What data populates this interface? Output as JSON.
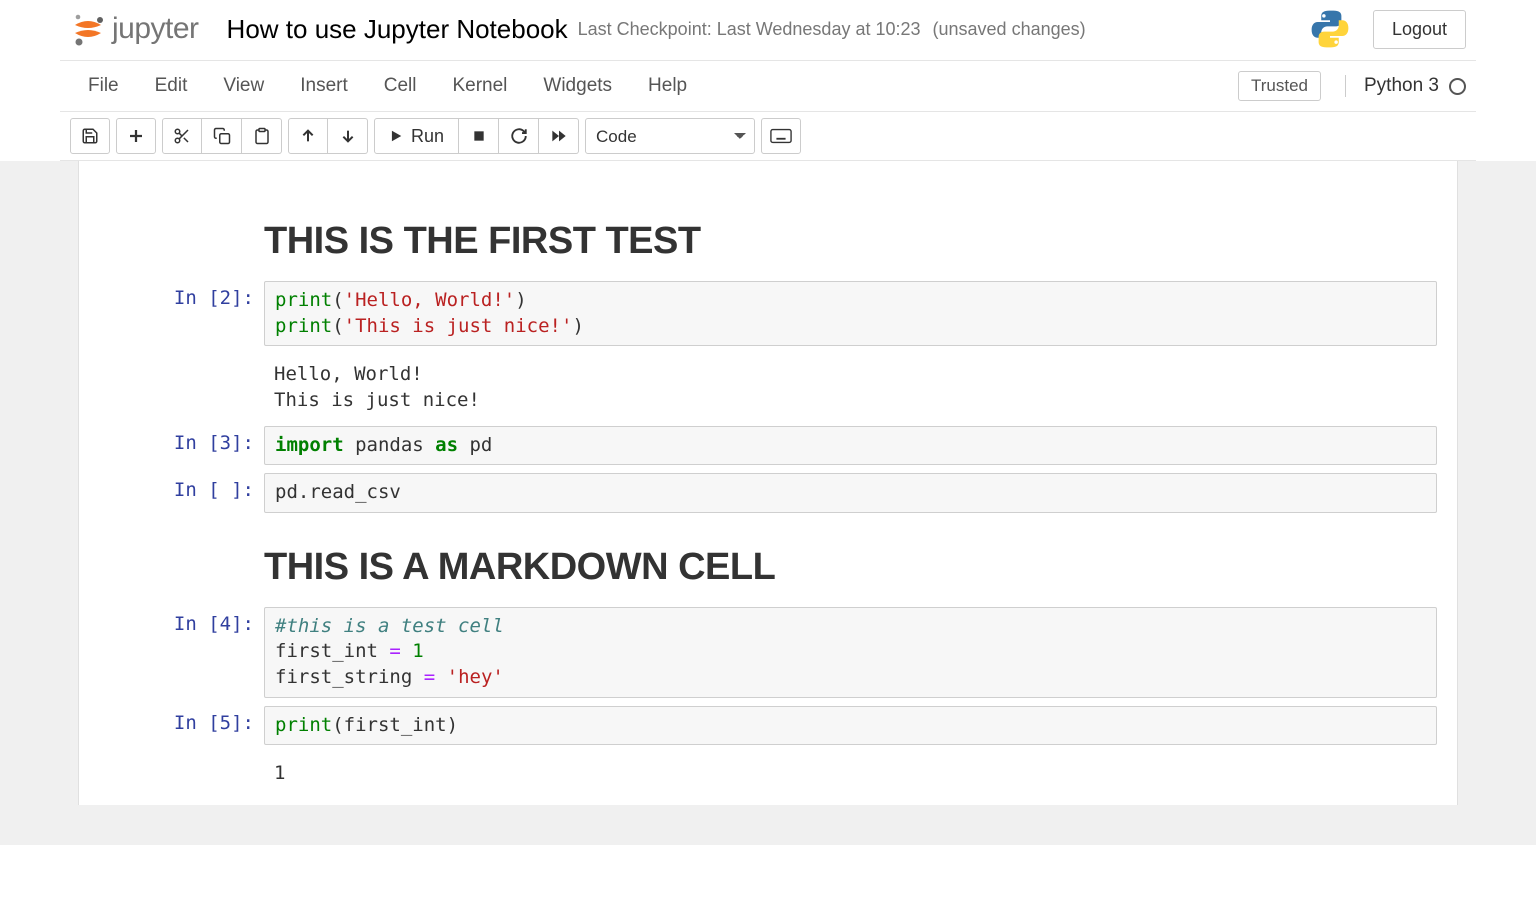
{
  "header": {
    "logo_text": "jupyter",
    "title": "How to use Jupyter Notebook",
    "checkpoint": "Last Checkpoint: Last Wednesday at 10:23",
    "unsaved": "(unsaved changes)",
    "logout": "Logout"
  },
  "menu": {
    "file": "File",
    "edit": "Edit",
    "view": "View",
    "insert": "Insert",
    "cell": "Cell",
    "kernel": "Kernel",
    "widgets": "Widgets",
    "help": "Help",
    "trusted": "Trusted",
    "kernel_name": "Python 3"
  },
  "toolbar": {
    "run_label": "Run",
    "celltype": "Code"
  },
  "cells": [
    {
      "type": "markdown",
      "rendered_h1": "THIS IS THE FIRST TEST"
    },
    {
      "type": "code",
      "prompt": "In [2]:",
      "source_tokens": [
        [
          "builtin",
          "print"
        ],
        [
          "plain",
          "("
        ],
        [
          "str",
          "'Hello, World!'"
        ],
        [
          "plain",
          ")\n"
        ],
        [
          "builtin",
          "print"
        ],
        [
          "plain",
          "("
        ],
        [
          "str",
          "'This is just nice!'"
        ],
        [
          "plain",
          ")"
        ]
      ],
      "output": "Hello, World!\nThis is just nice!"
    },
    {
      "type": "code",
      "prompt": "In [3]:",
      "source_tokens": [
        [
          "kw",
          "import"
        ],
        [
          "plain",
          " pandas "
        ],
        [
          "kw",
          "as"
        ],
        [
          "plain",
          " pd"
        ]
      ]
    },
    {
      "type": "code",
      "prompt": "In [ ]:",
      "source_tokens": [
        [
          "plain",
          "pd.read_csv"
        ]
      ]
    },
    {
      "type": "markdown",
      "rendered_h1": "THIS IS A MARKDOWN CELL"
    },
    {
      "type": "code",
      "prompt": "In [4]:",
      "source_tokens": [
        [
          "comment",
          "#this is a test cell"
        ],
        [
          "plain",
          "\nfirst_int "
        ],
        [
          "op",
          "="
        ],
        [
          "plain",
          " "
        ],
        [
          "num",
          "1"
        ],
        [
          "plain",
          "\nfirst_string "
        ],
        [
          "op",
          "="
        ],
        [
          "plain",
          " "
        ],
        [
          "str",
          "'hey'"
        ]
      ]
    },
    {
      "type": "code",
      "prompt": "In [5]:",
      "source_tokens": [
        [
          "builtin",
          "print"
        ],
        [
          "plain",
          "(first_int)"
        ]
      ],
      "output": "1"
    }
  ]
}
